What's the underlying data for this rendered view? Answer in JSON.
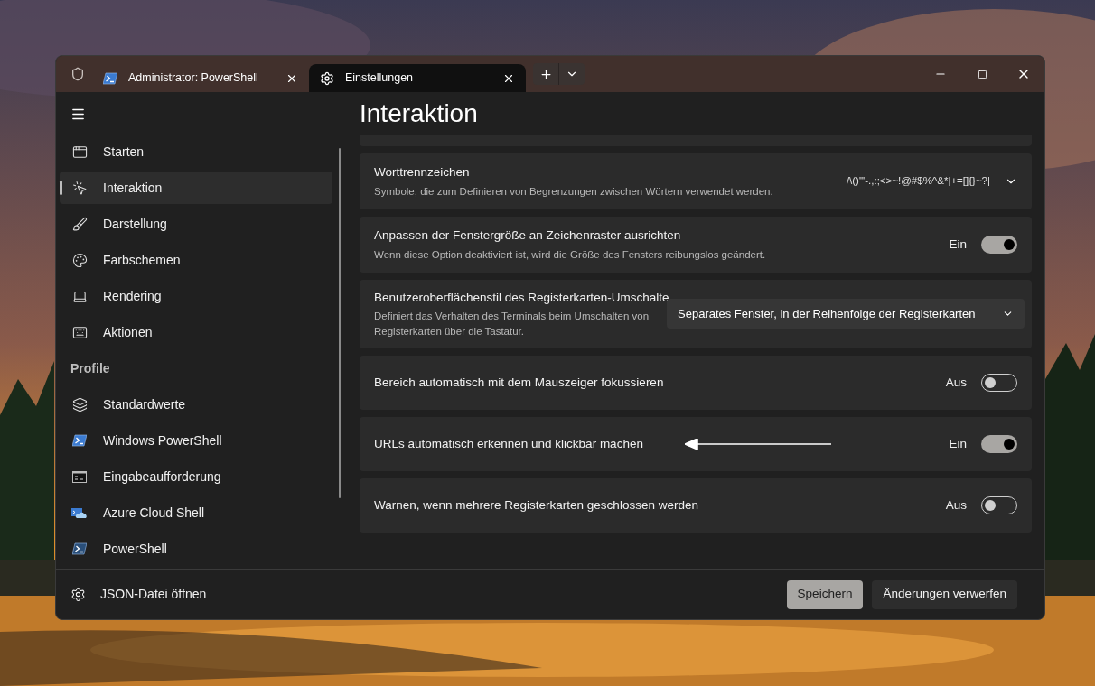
{
  "tabs": [
    {
      "label": "Administrator: PowerShell",
      "selected": false
    },
    {
      "label": "Einstellungen",
      "selected": true
    }
  ],
  "sidebar": {
    "items": [
      {
        "label": "Starten",
        "selected": false
      },
      {
        "label": "Interaktion",
        "selected": true
      },
      {
        "label": "Darstellung",
        "selected": false
      },
      {
        "label": "Farbschemen",
        "selected": false
      },
      {
        "label": "Rendering",
        "selected": false
      },
      {
        "label": "Aktionen",
        "selected": false
      }
    ],
    "section_label": "Profile",
    "profiles": [
      {
        "label": "Standardwerte",
        "selected": false
      },
      {
        "label": "Windows PowerShell",
        "selected": false
      },
      {
        "label": "Eingabeaufforderung",
        "selected": false
      },
      {
        "label": "Azure Cloud Shell",
        "selected": false
      },
      {
        "label": "PowerShell",
        "selected": false
      }
    ],
    "footer_link": "JSON-Datei öffnen"
  },
  "page_title": "Interaktion",
  "settings": [
    {
      "kind": "value",
      "title": "Worttrennzeichen",
      "description": "Symbole, die zum Definieren von Begrenzungen zwischen Wörtern verwendet werden.",
      "value": "/\\()\"'-.,:;<>~!@#$%^&*|+=[]{}~?|"
    },
    {
      "kind": "toggle",
      "title": "Anpassen der Fenstergröße an Zeichenraster ausrichten",
      "description": "Wenn diese Option deaktiviert ist, wird die Größe des Fensters reibungslos geändert.",
      "on": true,
      "state_label": "Ein"
    },
    {
      "kind": "combo",
      "title": "Benutzeroberflächenstil des Registerkarten-Umschalte",
      "description": "Definiert das Verhalten des Terminals beim Umschalten von Registerkarten über die Tastatur.",
      "value": "Separates Fenster, in der Reihenfolge der Registerkarten"
    },
    {
      "kind": "toggle",
      "title": "Bereich automatisch mit dem Mauszeiger fokussieren",
      "on": false,
      "state_label": "Aus"
    },
    {
      "kind": "toggle",
      "title": "URLs automatisch erkennen und klickbar machen",
      "on": true,
      "state_label": "Ein",
      "annotated": true
    },
    {
      "kind": "toggle",
      "title": "Warnen, wenn mehrere Registerkarten geschlossen werden",
      "on": false,
      "state_label": "Aus"
    }
  ],
  "buttons": [
    {
      "label": "Speichern",
      "kind": "primary"
    },
    {
      "label": "Änderungen verwerfen",
      "kind": "secondary"
    }
  ]
}
